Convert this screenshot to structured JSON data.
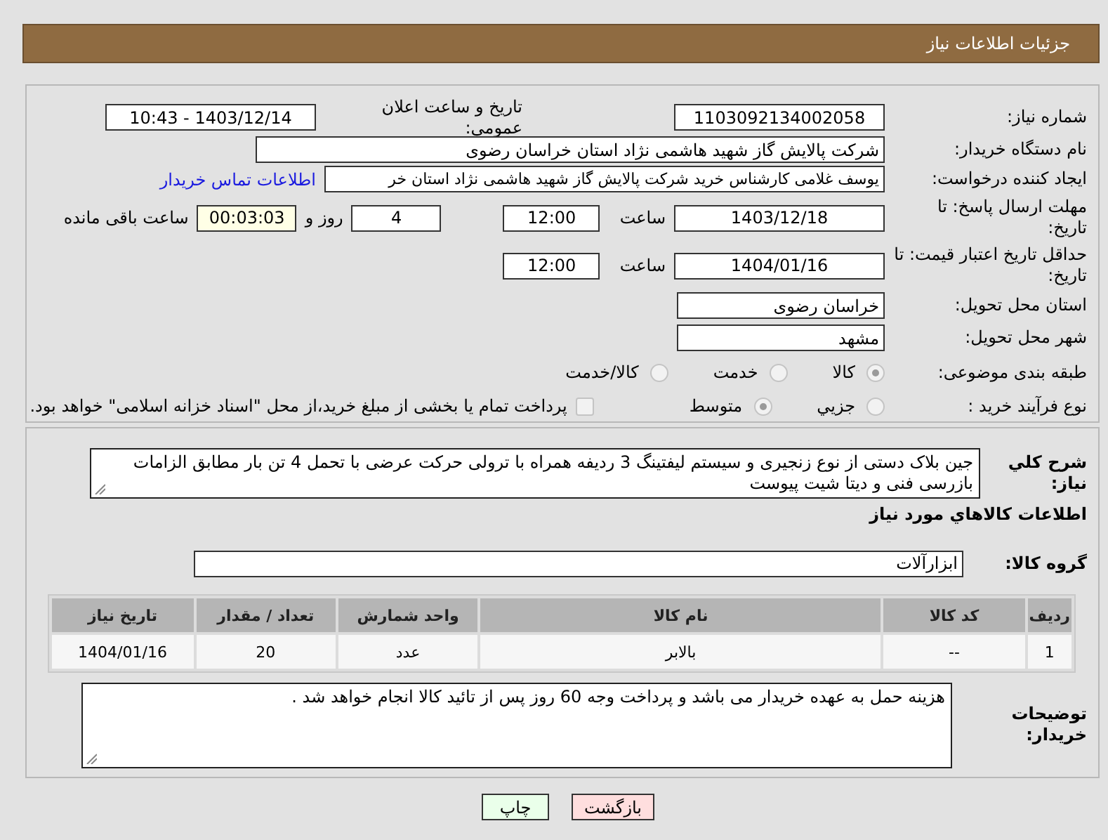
{
  "header": {
    "title": "جزئیات اطلاعات نیاز"
  },
  "need_number": {
    "label": "شماره نیاز:",
    "value": "1103092134002058"
  },
  "announce": {
    "label": "تاریخ و ساعت اعلان عمومی:",
    "value": "1403/12/14 - 10:43"
  },
  "buyer_org": {
    "label": "نام دستگاه خریدار:",
    "value": "شرکت پالایش گاز شهید هاشمی نژاد   استان خراسان رضوی"
  },
  "requester": {
    "label": "ایجاد کننده درخواست:",
    "value": "یوسف غلامی کارشناس خرید شرکت پالایش گاز شهید هاشمی نژاد   استان خر",
    "link": "اطلاعات تماس خریدار"
  },
  "deadline": {
    "label": "مهلت ارسال پاسخ: تا تاریخ:",
    "date": "1403/12/18",
    "time_label": "ساعت",
    "time": "12:00",
    "days": "4",
    "days_label": "روز و",
    "remaining": "00:03:03",
    "remaining_label": "ساعت باقی مانده"
  },
  "price_validity": {
    "label": "حداقل تاریخ اعتبار قیمت: تا تاریخ:",
    "date": "1404/01/16",
    "time_label": "ساعت",
    "time": "12:00"
  },
  "province": {
    "label": "استان محل تحویل:",
    "value": "خراسان رضوی"
  },
  "city": {
    "label": "شهر محل تحویل:",
    "value": "مشهد"
  },
  "category": {
    "label": "طبقه بندی موضوعی:",
    "options": [
      {
        "label": "کالا",
        "selected": true
      },
      {
        "label": "خدمت",
        "selected": false
      },
      {
        "label": "کالا/خدمت",
        "selected": false
      }
    ]
  },
  "process": {
    "label": "نوع فرآیند خرید :",
    "options": [
      {
        "label": "جزيي",
        "selected": false
      },
      {
        "label": "متوسط",
        "selected": true
      }
    ],
    "treasury": {
      "label": "پرداخت تمام یا بخشی از مبلغ خرید،از محل \"اسناد خزانه اسلامی\" خواهد بود.",
      "checked": false
    }
  },
  "description": {
    "label": "شرح کلي نیاز:",
    "value": "جین بلاک دستی از نوع زنجیری و سیستم لیفتینگ 3 ردیفه همراه با ترولی حرکت عرضی با تحمل 4 تن بار مطابق الزامات بازرسی فنی و دیتا شیت پیوست"
  },
  "goods_title": "اطلاعات کالاهاي مورد نياز",
  "goods_group": {
    "label": "گروه کالا:",
    "value": "ابزارآلات"
  },
  "table": {
    "columns": [
      "ردیف",
      "کد کالا",
      "نام کالا",
      "واحد شمارش",
      "تعداد / مقدار",
      "تاریخ نیاز"
    ],
    "rows": [
      [
        "1",
        "--",
        "بالابر",
        "عدد",
        "20",
        "1404/01/16"
      ]
    ]
  },
  "buyer_notes": {
    "label": "توضیحات خریدار:",
    "value": "هزینه حمل به عهده خریدار می باشد و پرداخت وجه 60 روز پس از تائید کالا انجام خواهد شد ."
  },
  "buttons": [
    {
      "label": "بازگشت",
      "kind": "back"
    },
    {
      "label": "چاپ",
      "kind": "print"
    }
  ]
}
